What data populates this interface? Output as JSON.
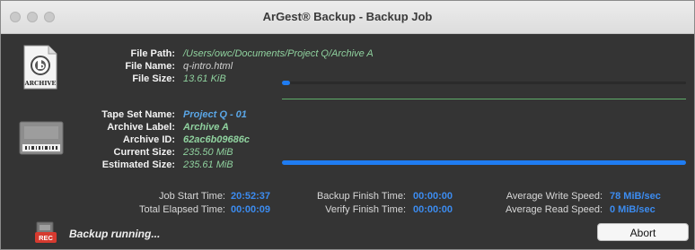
{
  "window": {
    "title": "ArGest® Backup - Backup Job"
  },
  "file": {
    "path_label": "File Path:",
    "path": "/Users/owc/Documents/Project Q/Archive A",
    "name_label": "File Name:",
    "name": "q-intro.html",
    "size_label": "File Size:",
    "size": "13.61 KiB",
    "progress": 0.02,
    "icon_text": "ARCHIVE"
  },
  "tape": {
    "set_name_label": "Tape Set Name:",
    "set_name": "Project Q - 01",
    "archive_label_label": "Archive Label:",
    "archive_label": "Archive A",
    "archive_id_label": "Archive ID:",
    "archive_id": "62ac6b09686c",
    "current_size_label": "Current Size:",
    "current_size": "235.50 MiB",
    "estimated_size_label": "Estimated Size:",
    "estimated_size": "235.61 MiB",
    "progress": 0.9995
  },
  "stats": {
    "job_start_label": "Job Start Time:",
    "job_start": "20:52:37",
    "elapsed_label": "Total Elapsed Time:",
    "elapsed": "00:00:09",
    "backup_finish_label": "Backup Finish Time:",
    "backup_finish": "00:00:00",
    "verify_finish_label": "Verify Finish Time:",
    "verify_finish": "00:00:00",
    "avg_write_label": "Average Write Speed:",
    "avg_write": "78 MiB/sec",
    "avg_read_label": "Average Read Speed:",
    "avg_read": "0 MiB/sec"
  },
  "status": {
    "text": "Backup running...",
    "icon_text": "REC"
  },
  "buttons": {
    "abort": "Abort"
  },
  "colors": {
    "progress": "#1f7cf2",
    "accent_blue": "#3c8cf0",
    "value_green": "#8fd19e"
  }
}
